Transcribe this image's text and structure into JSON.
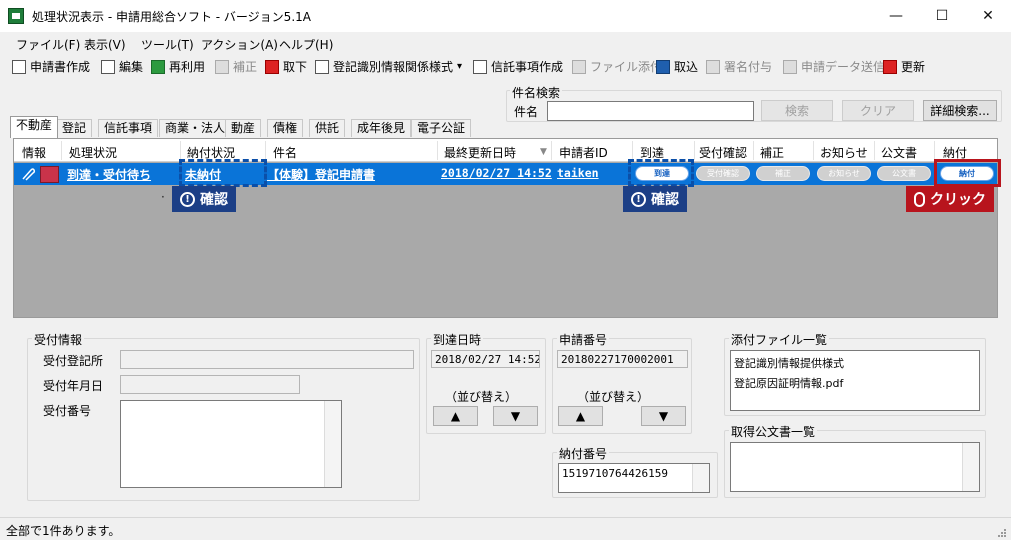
{
  "window": {
    "title": "処理状況表示 - 申請用総合ソフト - バージョン5.1A",
    "minimize": "—",
    "maximize": "☐",
    "close": "✕"
  },
  "menu": [
    "ファイル(F)",
    "表示(V)",
    "ツール(T)",
    "アクション(A)",
    "ヘルプ(H)"
  ],
  "toolbar": {
    "create": "申請書作成",
    "edit": "編集",
    "reuse": "再利用",
    "amend": "補正",
    "withdraw": "取下",
    "reg_info": "登記識別情報関係様式",
    "dropdown": "▾",
    "trust": "信託事項作成",
    "attach": "ファイル添付",
    "import": "取込",
    "sign": "署名付与",
    "send": "申請データ送信",
    "refresh": "更新"
  },
  "search": {
    "group_title": "件名検索",
    "label": "件名",
    "value": "",
    "search_btn": "検索",
    "clear_btn": "クリア",
    "detail_btn": "詳細検索..."
  },
  "tabs": [
    "不動産",
    "登記",
    "信託事項",
    "商業・法人",
    "動産",
    "債権",
    "供託",
    "成年後見",
    "電子公証"
  ],
  "grid": {
    "headers": {
      "info": "情報",
      "status": "処理状況",
      "payment": "納付状況",
      "subject": "件名",
      "updated": "最終更新日時",
      "applicant": "申請者ID",
      "arrival": "到達",
      "receipt": "受付確認",
      "amend": "補正",
      "notice": "お知らせ",
      "official": "公文書",
      "pay": "納付"
    },
    "sort_arrow": "▼",
    "row": {
      "status": "到達・受付待ち",
      "payment": "未納付",
      "subject": "【体験】登記申請書",
      "updated": "2018/02/27 14:52",
      "applicant": "taiken",
      "arrival": "到達",
      "receipt": "受付確認",
      "amend": "補正",
      "notice": "お知らせ",
      "official": "公文書",
      "pay": "納付"
    },
    "dot": "·"
  },
  "callouts": {
    "confirm": "確認",
    "click": "クリック",
    "info_mark": "!"
  },
  "details": {
    "reception_title": "受付情報",
    "reception_office_label": "受付登記所",
    "reception_date_label": "受付年月日",
    "reception_number_label": "受付番号",
    "arrival_title": "到達日時",
    "arrival_value": "2018/02/27 14:52",
    "sort_label": "（並び替え）",
    "up": "▲",
    "down": "▼",
    "app_number_title": "申請番号",
    "app_number_value": "20180227170002001",
    "payment_number_title": "納付番号",
    "payment_number_value": "1519710764426159",
    "attachments_title": "添付ファイル一覧",
    "attachments": [
      "登記識別情報提供様式",
      "登記原因証明情報.pdf"
    ],
    "official_docs_title": "取得公文書一覧"
  },
  "status": "全部で1件あります。"
}
